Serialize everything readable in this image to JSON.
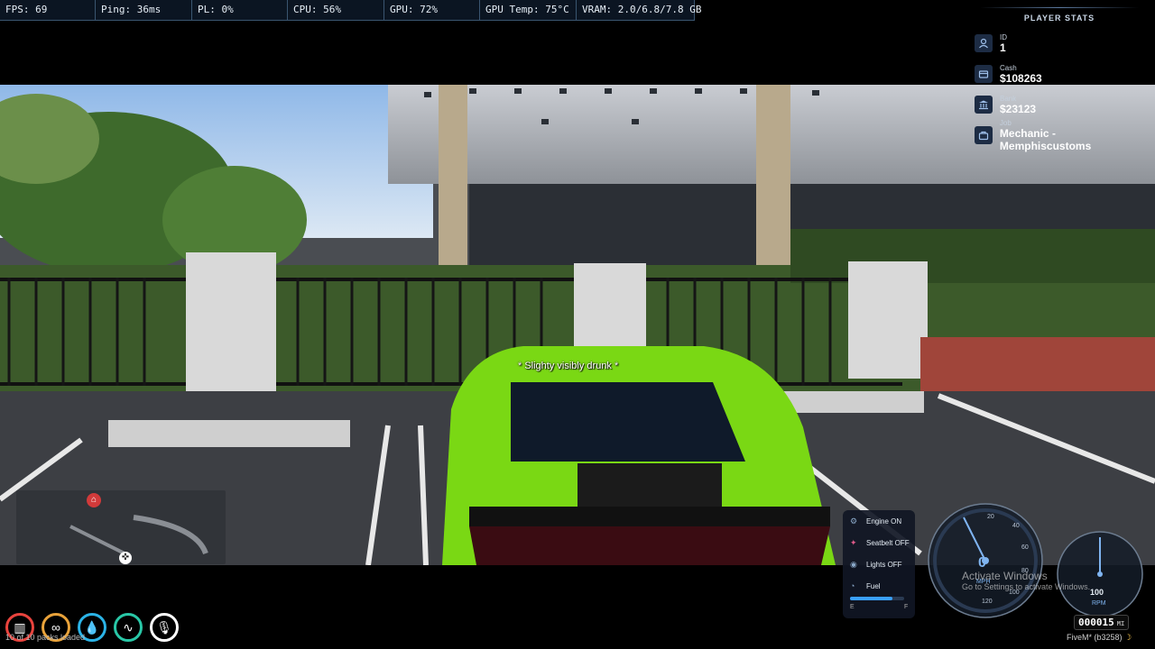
{
  "perf_bar": {
    "fps": "FPS: 69",
    "ping": "Ping: 36ms",
    "pl": "PL: 0%",
    "cpu": "CPU: 56%",
    "gpu": "GPU: 72%",
    "gpu_temp": "GPU Temp: 75°C",
    "vram": "VRAM: 2.0/6.8/7.8 GB"
  },
  "player_stats": {
    "title": "PLAYER STATS",
    "items": [
      {
        "label": "ID",
        "value": "1",
        "icon": "user-icon"
      },
      {
        "label": "Cash",
        "value": "$108263",
        "icon": "wallet-icon"
      },
      {
        "label": "Bank",
        "value": "$23123",
        "icon": "bank-icon"
      },
      {
        "label": "Job",
        "value": "Mechanic - Memphiscustoms",
        "icon": "briefcase-icon"
      }
    ]
  },
  "scene": {
    "status_text": "* Slighty visibly drunk *"
  },
  "vehicle_panel": {
    "engine": "Engine ON",
    "seatbelt": "Seatbelt OFF",
    "lights": "Lights OFF",
    "fuel_label": "Fuel",
    "fuel_empty": "E",
    "fuel_full": "F",
    "fuel_level": 0.78
  },
  "speedometer": {
    "speed": "0",
    "unit": "MPH",
    "ticks": [
      "20",
      "40",
      "60",
      "80",
      "100",
      "120"
    ],
    "needle_value": 0
  },
  "tachometer": {
    "value": "100",
    "unit": "RPM"
  },
  "odometer": {
    "value": "000015",
    "unit": "MI"
  },
  "watermark": {
    "line1": "Activate Windows",
    "line2": "Go to Settings to activate Windows."
  },
  "client": {
    "version": "FiveM* (b3258)"
  },
  "notification": {
    "text": "10 of 10 packs loaded"
  },
  "colors": {
    "hunger": "#e8433d",
    "thirst": "#2bb3e6",
    "stamina": "#e8a23a",
    "stress": "#29c7a7",
    "voice": "#ffffff",
    "car": "#7ad814"
  }
}
